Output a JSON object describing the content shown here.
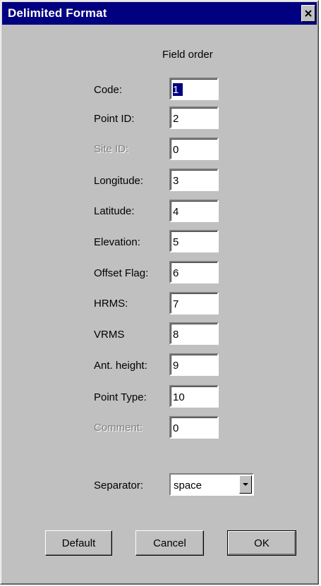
{
  "window": {
    "title": "Delimited Format"
  },
  "header": {
    "field_order": "Field order"
  },
  "fields": [
    {
      "label": "Code:",
      "value": "1",
      "disabled": false
    },
    {
      "label": "Point ID:",
      "value": "2",
      "disabled": false
    },
    {
      "label": "Site ID:",
      "value": "0",
      "disabled": true
    },
    {
      "label": "Longitude:",
      "value": "3",
      "disabled": false
    },
    {
      "label": "Latitude:",
      "value": "4",
      "disabled": false
    },
    {
      "label": "Elevation:",
      "value": "5",
      "disabled": false
    },
    {
      "label": "Offset Flag:",
      "value": "6",
      "disabled": false
    },
    {
      "label": "HRMS:",
      "value": "7",
      "disabled": false
    },
    {
      "label": "VRMS",
      "value": "8",
      "disabled": false
    },
    {
      "label": "Ant. height:",
      "value": "9",
      "disabled": false
    },
    {
      "label": "Point Type:",
      "value": "10",
      "disabled": false
    },
    {
      "label": "Comment:",
      "value": "0",
      "disabled": true
    }
  ],
  "separator": {
    "label": "Separator:",
    "value": "space"
  },
  "buttons": {
    "default": "Default",
    "cancel": "Cancel",
    "ok": "OK"
  },
  "icons": {
    "close": "close-icon",
    "dropdown": "chevron-down-icon"
  },
  "colors": {
    "titlebar": "#000080",
    "face": "#c0c0c0",
    "disabled_text": "#808080"
  }
}
